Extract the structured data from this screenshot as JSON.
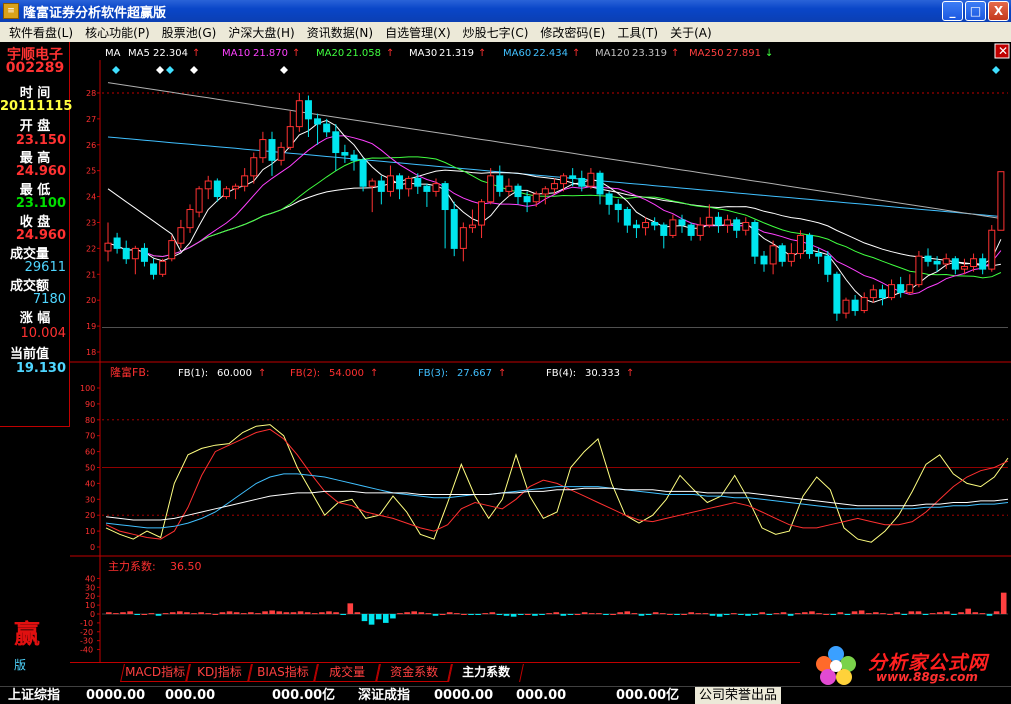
{
  "window": {
    "title": "隆富证券分析软件超赢版",
    "minimize": "_",
    "maximize": "□",
    "close": "X"
  },
  "menu": [
    "软件看盘(L)",
    "核心功能(P)",
    "股票池(G)",
    "沪深大盘(H)",
    "资讯数据(N)",
    "自选管理(X)",
    "炒股七字(C)",
    "修改密码(E)",
    "工具(T)",
    "关于(A)"
  ],
  "stock": {
    "name": "宇顺电子",
    "code": "002289",
    "time_label": "时  间",
    "date": "20111115",
    "open_label": "开  盘",
    "open": "23.150",
    "high_label": "最  高",
    "high": "24.960",
    "low_label": "最  低",
    "low": "23.100",
    "close_label": "收  盘",
    "close": "24.960",
    "volume_label": "成交量",
    "volume": "29611",
    "amount_label": "成交额",
    "amount": "7180",
    "change_label": "涨  幅",
    "change": "10.004",
    "current_label": "当前值",
    "current": "19.130"
  },
  "ma_legend": [
    {
      "label": "MA",
      "value": "",
      "color": "#ffffff",
      "arrow": ""
    },
    {
      "label": "MA5",
      "value": "22.304",
      "color": "#ffffff",
      "arrow": "↑",
      "arrow_color": "#ff3030"
    },
    {
      "label": "MA10",
      "value": "21.870",
      "color": "#ff40ff",
      "arrow": "↑",
      "arrow_color": "#ff3030"
    },
    {
      "label": "MA20",
      "value": "21.058",
      "color": "#40ff40",
      "arrow": "↑",
      "arrow_color": "#ff3030"
    },
    {
      "label": "MA30",
      "value": "21.319",
      "color": "#ffffff",
      "arrow": "↑",
      "arrow_color": "#ff3030"
    },
    {
      "label": "MA60",
      "value": "22.434",
      "color": "#40c0ff",
      "arrow": "↑",
      "arrow_color": "#ff3030"
    },
    {
      "label": "MA120",
      "value": "23.319",
      "color": "#c0c0c0",
      "arrow": "↑",
      "arrow_color": "#ff3030"
    },
    {
      "label": "MA250",
      "value": "27.891",
      "color": "#ff4040",
      "arrow": "↓",
      "arrow_color": "#40ff40"
    }
  ],
  "fb_legend": {
    "title": "隆富FB:",
    "items": [
      {
        "label": "FB(1):",
        "value": "60.000",
        "color": "#ffffff"
      },
      {
        "label": "FB(2):",
        "value": "54.000",
        "color": "#ff3030"
      },
      {
        "label": "FB(3):",
        "value": "27.667",
        "color": "#40c0ff"
      },
      {
        "label": "FB(4):",
        "value": "30.333",
        "color": "#ffffff"
      }
    ]
  },
  "zl_legend": {
    "label": "主力系数:",
    "value": "36.50"
  },
  "tabs": [
    "MACD指标",
    "KDJ指标",
    "BIAS指标",
    "成交量",
    "资金系数",
    "主力系数"
  ],
  "active_tab": 5,
  "logo": {
    "text": "分析家公式网",
    "url": "www.88gs.com"
  },
  "side_marks": {
    "ying": "赢",
    "ban": "版"
  },
  "statusbar": {
    "sh_label": "上证综指",
    "sh_v1": "0000.00",
    "sh_v2": "000.00",
    "sh_amt": "000.00亿",
    "sz_label": "深证成指",
    "sz_v1": "0000.00",
    "sz_v2": "000.00",
    "sz_amt": "000.00亿",
    "copyright": "公司荣誉出品"
  },
  "chart_data": [
    {
      "type": "candlestick",
      "ylim": [
        18,
        28.5
      ],
      "yticks": [
        18,
        19,
        20,
        21,
        22,
        23,
        24,
        25,
        26,
        27,
        28
      ],
      "candles": [
        [
          21.9,
          22.2,
          23.0,
          21.5
        ],
        [
          22.4,
          22.0,
          22.6,
          21.8
        ],
        [
          22.0,
          21.6,
          22.3,
          21.4
        ],
        [
          21.6,
          22.0,
          22.1,
          21.0
        ],
        [
          22.0,
          21.5,
          22.2,
          21.3
        ],
        [
          21.4,
          21.0,
          21.6,
          20.8
        ],
        [
          21.0,
          21.5,
          21.6,
          20.9
        ],
        [
          21.6,
          22.3,
          22.5,
          21.5
        ],
        [
          22.2,
          22.8,
          23.1,
          22.0
        ],
        [
          22.8,
          23.5,
          23.7,
          22.6
        ],
        [
          23.4,
          24.3,
          24.4,
          23.2
        ],
        [
          24.3,
          24.6,
          24.8,
          23.9
        ],
        [
          24.6,
          24.0,
          24.7,
          23.8
        ],
        [
          24.0,
          24.3,
          24.4,
          23.9
        ],
        [
          24.3,
          24.4,
          24.5,
          23.9
        ],
        [
          24.4,
          24.8,
          25.1,
          24.2
        ],
        [
          24.8,
          25.5,
          25.7,
          24.5
        ],
        [
          25.5,
          26.2,
          26.5,
          25.3
        ],
        [
          26.2,
          25.4,
          26.5,
          24.8
        ],
        [
          25.4,
          25.9,
          26.1,
          25.2
        ],
        [
          25.9,
          26.7,
          27.3,
          25.8
        ],
        [
          26.7,
          27.7,
          28.0,
          26.5
        ],
        [
          27.7,
          27.0,
          27.9,
          26.3
        ],
        [
          27.0,
          26.8,
          27.2,
          26.0
        ],
        [
          26.8,
          26.5,
          27.0,
          26.3
        ],
        [
          26.5,
          25.7,
          26.8,
          25.0
        ],
        [
          25.7,
          25.6,
          26.0,
          25.3
        ],
        [
          25.6,
          25.4,
          25.8,
          25.0
        ],
        [
          25.4,
          24.4,
          25.5,
          24.2
        ],
        [
          24.4,
          24.6,
          24.7,
          23.4
        ],
        [
          24.6,
          24.2,
          24.8,
          23.7
        ],
        [
          24.2,
          24.8,
          25.2,
          24.0
        ],
        [
          24.8,
          24.3,
          24.9,
          23.9
        ],
        [
          24.3,
          24.7,
          24.8,
          24.0
        ],
        [
          24.7,
          24.4,
          24.9,
          24.1
        ],
        [
          24.4,
          24.2,
          24.5,
          23.6
        ],
        [
          24.2,
          24.5,
          24.7,
          24.0
        ],
        [
          24.5,
          23.5,
          24.6,
          22.0
        ],
        [
          23.5,
          22.0,
          23.8,
          21.7
        ],
        [
          22.0,
          22.8,
          23.0,
          21.5
        ],
        [
          22.8,
          22.9,
          23.5,
          22.6
        ],
        [
          22.9,
          23.8,
          23.9,
          22.4
        ],
        [
          23.8,
          24.8,
          25.1,
          23.7
        ],
        [
          24.8,
          24.2,
          25.2,
          24.0
        ],
        [
          24.2,
          24.4,
          24.7,
          24.0
        ],
        [
          24.4,
          24.0,
          24.5,
          23.7
        ],
        [
          24.0,
          23.8,
          24.2,
          23.4
        ],
        [
          23.8,
          24.1,
          24.2,
          23.6
        ],
        [
          24.1,
          24.3,
          24.4,
          23.7
        ],
        [
          24.3,
          24.5,
          24.7,
          24.1
        ],
        [
          24.5,
          24.8,
          24.9,
          24.2
        ],
        [
          24.8,
          24.7,
          25.1,
          24.4
        ],
        [
          24.7,
          24.4,
          25.0,
          24.2
        ],
        [
          24.4,
          24.9,
          25.1,
          24.3
        ],
        [
          24.9,
          24.1,
          25.0,
          23.7
        ],
        [
          24.1,
          23.7,
          24.2,
          23.3
        ],
        [
          23.7,
          23.5,
          23.9,
          23.0
        ],
        [
          23.5,
          22.9,
          23.6,
          22.6
        ],
        [
          22.9,
          22.8,
          23.1,
          22.4
        ],
        [
          22.8,
          23.0,
          23.2,
          22.5
        ],
        [
          23.0,
          22.9,
          23.2,
          22.7
        ],
        [
          22.9,
          22.5,
          23.0,
          22.0
        ],
        [
          22.5,
          23.1,
          23.3,
          22.4
        ],
        [
          23.1,
          22.9,
          23.3,
          22.6
        ],
        [
          22.9,
          22.5,
          23.0,
          22.3
        ],
        [
          22.5,
          22.9,
          23.2,
          22.3
        ],
        [
          22.9,
          23.2,
          23.7,
          22.8
        ],
        [
          23.2,
          22.9,
          23.4,
          22.6
        ],
        [
          22.9,
          23.1,
          23.3,
          22.6
        ],
        [
          23.1,
          22.7,
          23.2,
          22.4
        ],
        [
          22.7,
          23.0,
          23.2,
          22.5
        ],
        [
          23.0,
          21.7,
          23.1,
          21.4
        ],
        [
          21.7,
          21.4,
          21.9,
          21.1
        ],
        [
          21.4,
          22.1,
          22.3,
          21.0
        ],
        [
          22.1,
          21.5,
          22.2,
          21.3
        ],
        [
          21.5,
          21.8,
          22.2,
          21.3
        ],
        [
          21.8,
          22.5,
          22.7,
          21.6
        ],
        [
          22.5,
          21.8,
          22.6,
          21.6
        ],
        [
          21.8,
          21.7,
          22.0,
          21.4
        ],
        [
          21.7,
          21.0,
          21.9,
          20.7
        ],
        [
          21.0,
          19.5,
          21.1,
          19.2
        ],
        [
          19.5,
          20.0,
          20.1,
          19.3
        ],
        [
          20.0,
          19.6,
          20.2,
          19.4
        ],
        [
          19.6,
          20.1,
          20.3,
          19.5
        ],
        [
          20.1,
          20.4,
          20.6,
          19.9
        ],
        [
          20.4,
          20.1,
          20.6,
          19.8
        ],
        [
          20.1,
          20.6,
          20.8,
          20.0
        ],
        [
          20.6,
          20.3,
          20.9,
          20.1
        ],
        [
          20.3,
          20.6,
          21.0,
          20.2
        ],
        [
          20.6,
          21.7,
          21.9,
          20.5
        ],
        [
          21.7,
          21.5,
          22.0,
          21.3
        ],
        [
          21.5,
          21.4,
          21.7,
          21.1
        ],
        [
          21.4,
          21.6,
          21.8,
          21.2
        ],
        [
          21.6,
          21.2,
          21.7,
          21.0
        ],
        [
          21.2,
          21.3,
          21.6,
          21.0
        ],
        [
          21.3,
          21.6,
          21.8,
          21.1
        ],
        [
          21.6,
          21.2,
          21.8,
          21.0
        ],
        [
          21.2,
          22.7,
          22.9,
          21.1
        ],
        [
          22.7,
          24.96,
          24.96,
          23.1
        ]
      ]
    },
    {
      "type": "line",
      "ylim": [
        0,
        100
      ],
      "yticks": [
        0,
        10,
        20,
        30,
        40,
        50,
        60,
        70,
        80,
        90,
        100
      ],
      "series": [
        {
          "name": "FB(1)",
          "color": "#ffff80",
          "values": [
            12,
            8,
            5,
            10,
            6,
            40,
            58,
            62,
            64,
            65,
            72,
            76,
            77,
            70,
            50,
            35,
            20,
            28,
            30,
            18,
            20,
            32,
            22,
            8,
            5,
            28,
            52,
            32,
            18,
            30,
            58,
            32,
            18,
            22,
            50,
            60,
            68,
            40,
            20,
            15,
            20,
            30,
            45,
            36,
            28,
            32,
            45,
            30,
            12,
            8,
            10,
            32,
            44,
            36,
            12,
            5,
            3,
            10,
            20,
            35,
            52,
            58,
            46,
            40,
            38,
            44,
            56
          ]
        },
        {
          "name": "FB(2)",
          "color": "#ff3030",
          "values": [
            14,
            10,
            8,
            6,
            5,
            10,
            25,
            45,
            60,
            64,
            68,
            72,
            74,
            68,
            58,
            46,
            35,
            28,
            26,
            22,
            20,
            18,
            15,
            12,
            10,
            14,
            24,
            28,
            26,
            24,
            30,
            38,
            42,
            40,
            36,
            32,
            28,
            24,
            20,
            17,
            16,
            18,
            20,
            22,
            24,
            26,
            28,
            26,
            22,
            18,
            14,
            12,
            12,
            14,
            16,
            18,
            16,
            14,
            14,
            16,
            22,
            30,
            38,
            44,
            48,
            50,
            54
          ]
        },
        {
          "name": "FB(3)",
          "color": "#40c0ff",
          "values": [
            15,
            14,
            13,
            12,
            12,
            13,
            15,
            18,
            22,
            28,
            34,
            40,
            44,
            46,
            46,
            45,
            44,
            42,
            40,
            38,
            36,
            34,
            33,
            32,
            31,
            31,
            32,
            33,
            33,
            34,
            35,
            36,
            37,
            38,
            38,
            38,
            38,
            37,
            36,
            35,
            34,
            33,
            33,
            33,
            32,
            32,
            31,
            31,
            30,
            29,
            28,
            27,
            26,
            25,
            24,
            24,
            24,
            24,
            24,
            24,
            25,
            25,
            26,
            26,
            27,
            27,
            28
          ]
        },
        {
          "name": "FB(4)",
          "color": "#ffffff",
          "values": [
            19,
            18,
            17,
            17,
            17,
            18,
            20,
            22,
            24,
            26,
            28,
            30,
            32,
            33,
            34,
            34,
            35,
            35,
            35,
            34,
            34,
            34,
            34,
            33,
            33,
            33,
            33,
            33,
            33,
            34,
            34,
            35,
            35,
            36,
            36,
            37,
            37,
            37,
            36,
            36,
            36,
            35,
            35,
            35,
            34,
            34,
            34,
            34,
            33,
            32,
            31,
            30,
            29,
            28,
            27,
            26,
            26,
            26,
            26,
            26,
            27,
            27,
            28,
            28,
            29,
            29,
            30
          ]
        }
      ]
    },
    {
      "type": "bar",
      "ylim": [
        -45,
        45
      ],
      "yticks": [
        -40,
        -30,
        -20,
        -10,
        0,
        10,
        20,
        30,
        40
      ],
      "values": [
        2,
        1,
        2,
        3,
        -1,
        0,
        1,
        -2,
        1,
        2,
        3,
        2,
        1,
        2,
        1,
        0,
        2,
        3,
        2,
        1,
        2,
        1,
        3,
        4,
        3,
        2,
        2,
        3,
        2,
        1,
        2,
        3,
        2,
        -1,
        12,
        2,
        -8,
        -12,
        -6,
        -10,
        -5,
        1,
        2,
        3,
        2,
        1,
        -2,
        0,
        2,
        1,
        0,
        -1,
        -1,
        1,
        2,
        -1,
        -2,
        -3,
        -1,
        0,
        -2,
        -1,
        1,
        2,
        -2,
        -1,
        0,
        2,
        1,
        1,
        -1,
        0,
        2,
        3,
        1,
        -2,
        -1,
        2,
        1,
        0,
        -1,
        0,
        2,
        1,
        1,
        -2,
        -3,
        -1,
        1,
        -1,
        -2,
        -1,
        2,
        -1,
        1,
        2,
        -2,
        1,
        2,
        3,
        1,
        0,
        -1,
        2,
        -1,
        3,
        4,
        1,
        2,
        1,
        0,
        2,
        -1,
        3,
        3,
        -1,
        1,
        2,
        3,
        -1,
        2,
        6,
        2,
        1,
        -2,
        3,
        24
      ]
    }
  ]
}
